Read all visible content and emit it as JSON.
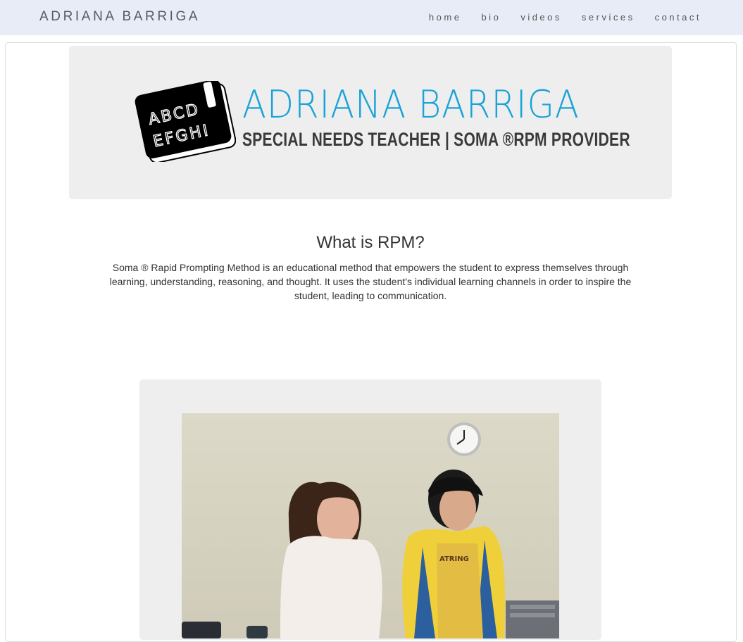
{
  "nav": {
    "brand": "ADRIANA BARRIGA",
    "links": [
      "home",
      "bio",
      "videos",
      "services",
      "contact"
    ]
  },
  "hero": {
    "logo_letters_row1": "ABCD",
    "logo_letters_row2": "EFGHI",
    "title": "ADRIANA BARRIGA",
    "subtitle": "SPECIAL NEEDS TEACHER | SOMA ®RPM PROVIDER"
  },
  "rpm": {
    "heading": "What is RPM?",
    "body": "Soma ® Rapid Prompting Method is an educational method that empowers the student to express themselves through learning, understanding, reasoning, and thought. It uses the student's individual learning channels in order to inspire the student, leading to communication."
  },
  "photo": {
    "shirt_text": "ATRING"
  },
  "colors": {
    "navbar_bg": "#e8ecf7",
    "brand_blue": "#1aa3d8",
    "card_bg": "#eeeeee"
  }
}
